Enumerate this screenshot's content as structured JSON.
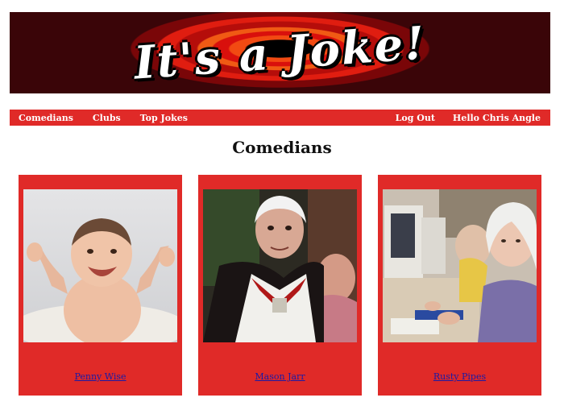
{
  "banner": {
    "title": "It's a Joke!"
  },
  "nav": {
    "left": [
      "Comedians",
      "Clubs",
      "Top Jokes"
    ],
    "logout": "Log Out",
    "greeting": "Hello Chris Angle"
  },
  "page": {
    "title": "Comedians"
  },
  "comedians": [
    {
      "name": "Penny Wise"
    },
    {
      "name": "Mason Jarr"
    },
    {
      "name": "Rusty Pipes"
    }
  ],
  "colors": {
    "accent": "#e02a28",
    "link": "#1a1aa6"
  }
}
